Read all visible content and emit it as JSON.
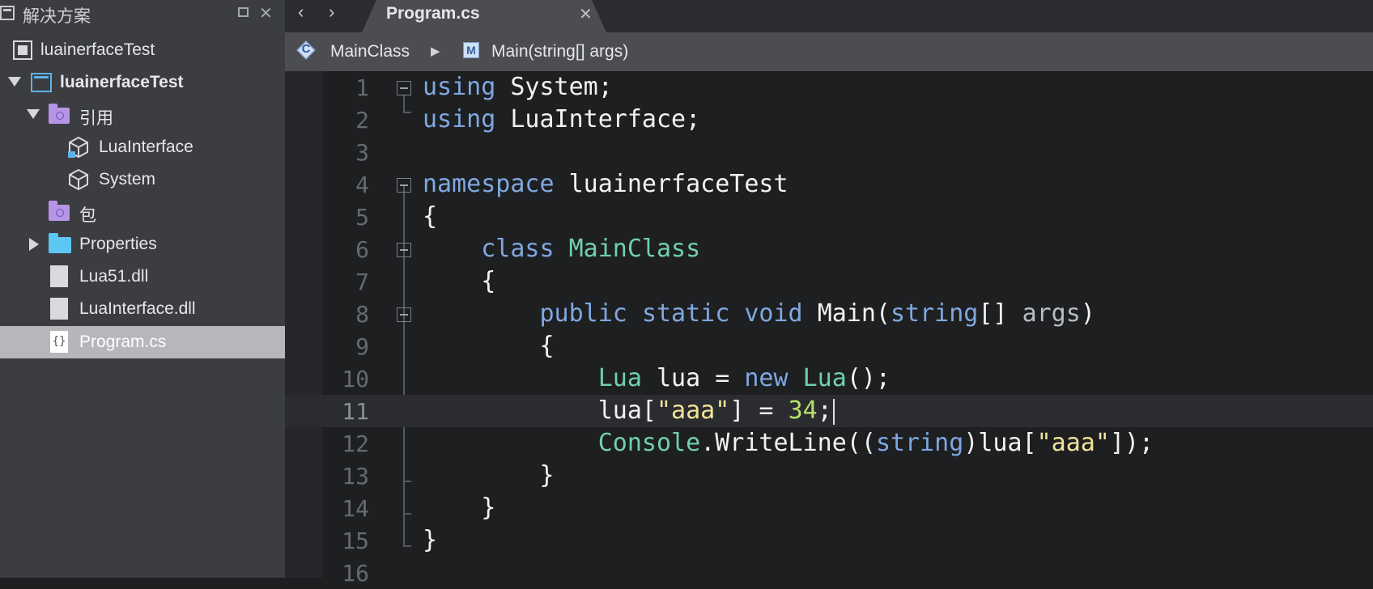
{
  "pad": {
    "title": "解决方案",
    "min_label": "",
    "close_label": "✕"
  },
  "tree": {
    "solution": "luainerfaceTest",
    "project": "luainerfaceTest",
    "references": "引用",
    "ref_luainterface": "LuaInterface",
    "ref_system": "System",
    "packages": "包",
    "properties": "Properties",
    "file_lua51": "Lua51.dll",
    "file_luainterface": "LuaInterface.dll",
    "file_program": "Program.cs",
    "cs_icon_glyph": "{}"
  },
  "tabbar": {
    "back": "‹",
    "forward": "›",
    "tab_label": "Program.cs",
    "tab_close": "✕"
  },
  "breadcrumb": {
    "class_icon_glyph": "C",
    "class_name": "MainClass",
    "separator": "▶",
    "method_icon_glyph": "M",
    "method_name": "Main(string[] args)"
  },
  "code": {
    "lines": [
      "1",
      "2",
      "3",
      "4",
      "5",
      "6",
      "7",
      "8",
      "9",
      "10",
      "11",
      "12",
      "13",
      "14",
      "15",
      "16"
    ],
    "t_using": "using",
    "t_system": " System;",
    "t_luainterface": " LuaInterface;",
    "t_namespace": "namespace",
    "t_ns_name": " luainerfaceTest",
    "t_open": "{",
    "t_close": "}",
    "t_class": "class",
    "t_mainclass": "MainClass",
    "t_public": "public",
    "t_static": "static",
    "t_void": "void",
    "t_main": "Main(",
    "t_string": "string",
    "t_brackets": "[] ",
    "t_args": "args",
    "t_paren_close": ")",
    "t_lua_type": "Lua",
    "t_lua_var": " lua = ",
    "t_new": "new",
    "t_lua_ctor": "Lua",
    "t_ctor_end": "();",
    "t_lua_index": "lua[",
    "t_aaa": "\"aaa\"",
    "t_assign": "] = ",
    "t_34": "34",
    "t_semi": ";",
    "t_console": "Console",
    "t_writeline": ".WriteLine((",
    "t_cast_end": ")lua[",
    "t_call_end": "]);"
  },
  "colors": {
    "keyword": "#7fa8e0",
    "type": "#6fd0ac",
    "string": "#f0e39a",
    "number": "#b5e06a",
    "selection": "#b5b7ba"
  }
}
